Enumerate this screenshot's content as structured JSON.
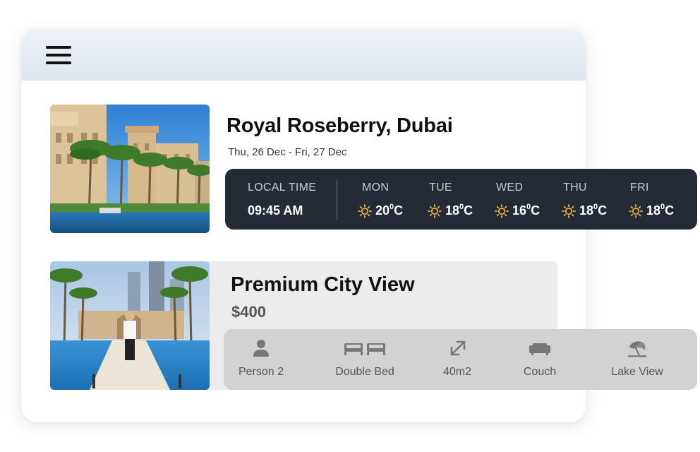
{
  "menu": {
    "icon": "hamburger-menu-icon"
  },
  "hotel": {
    "name": "Royal Roseberry, Dubai",
    "dates": "Thu, 26 Dec - Fri, 27 Dec",
    "photo": "hotel-exterior-photo"
  },
  "weather": {
    "local_time_label": "LOCAL TIME",
    "local_time": "09:45 AM",
    "icon": "sun-icon",
    "unit": "C",
    "days": [
      {
        "day": "MON",
        "temp": "20"
      },
      {
        "day": "TUE",
        "temp": "18"
      },
      {
        "day": "WED",
        "temp": "16"
      },
      {
        "day": "THU",
        "temp": "18"
      },
      {
        "day": "FRI",
        "temp": "18"
      }
    ]
  },
  "room": {
    "name": "Premium City View",
    "price": "$400",
    "photo": "pool-walkway-photo",
    "amenities": [
      {
        "label": "Person 2",
        "icon": "person-icon"
      },
      {
        "label": "Double Bed",
        "icon": "double-bed-icon"
      },
      {
        "label": "40m2",
        "icon": "expand-arrow-icon"
      },
      {
        "label": "Couch",
        "icon": "couch-icon"
      },
      {
        "label": "Lake View",
        "icon": "beach-umbrella-icon"
      }
    ]
  },
  "colors": {
    "weather_bg": "#252b36",
    "amenity_bg": "#d2d2d2",
    "sun": "#e8b23a"
  }
}
